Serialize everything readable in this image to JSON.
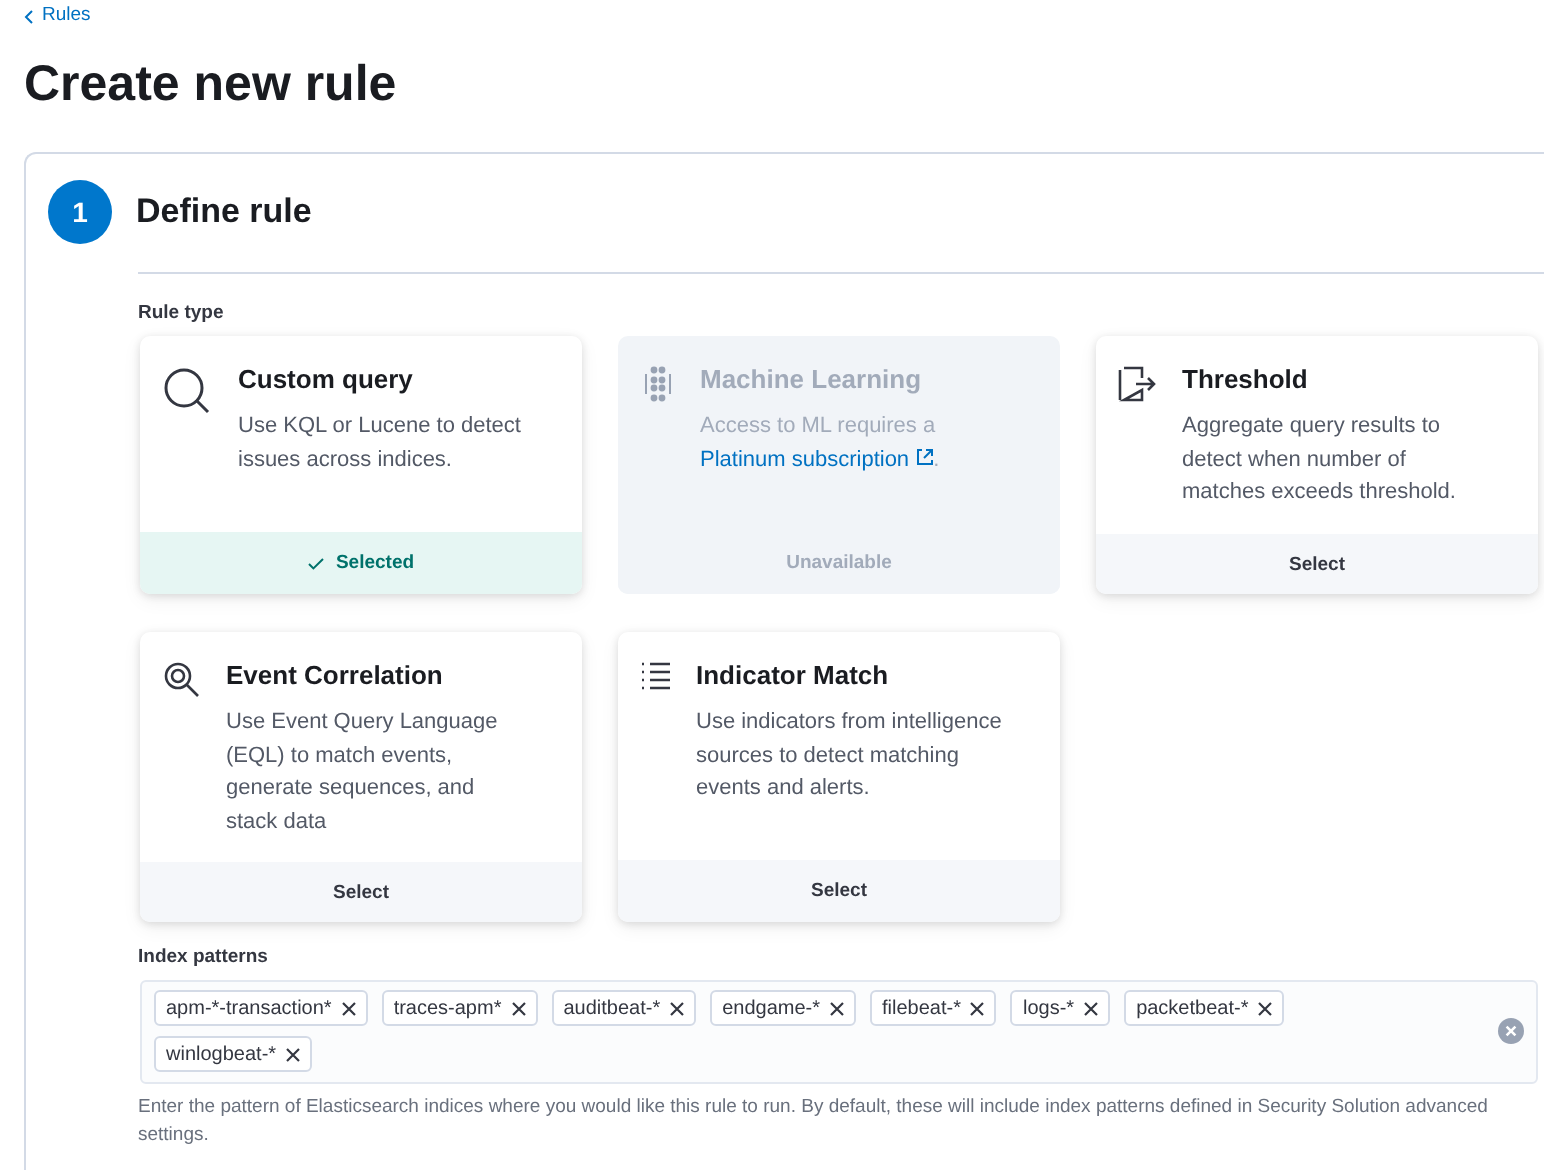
{
  "breadcrumb": {
    "label": "Rules"
  },
  "title": "Create new rule",
  "step": {
    "number": "1",
    "title": "Define rule"
  },
  "rule_type": {
    "label": "Rule type",
    "cards": [
      {
        "kind": "custom_query",
        "title": "Custom query",
        "description": "Use KQL or Lucene to detect issues across indices.",
        "footer": "Selected",
        "selected": true,
        "disabled": false
      },
      {
        "kind": "machine_learning",
        "title": "Machine Learning",
        "description": "Access to ML requires a",
        "link": "Platinum subscription",
        "suffix": ".",
        "footer": "Unavailable",
        "selected": false,
        "disabled": true
      },
      {
        "kind": "threshold",
        "title": "Threshold",
        "description": "Aggregate query results to detect when number of matches exceeds threshold.",
        "footer": "Select",
        "selected": false,
        "disabled": false
      },
      {
        "kind": "eql",
        "title": "Event Correlation",
        "description": "Use Event Query Language (EQL) to match events, generate sequences, and stack data",
        "footer": "Select",
        "selected": false,
        "disabled": false
      },
      {
        "kind": "threat_match",
        "title": "Indicator Match",
        "description": "Use indicators from intelligence sources to detect matching events and alerts.",
        "footer": "Select",
        "selected": false,
        "disabled": false
      }
    ]
  },
  "index_patterns": {
    "label": "Index patterns",
    "values": [
      "apm-*-transaction*",
      "traces-apm*",
      "auditbeat-*",
      "endgame-*",
      "filebeat-*",
      "logs-*",
      "packetbeat-*",
      "winlogbeat-*"
    ],
    "help": "Enter the pattern of Elasticsearch indices where you would like this rule to run. By default, these will include index patterns defined in Security Solution advanced settings."
  }
}
